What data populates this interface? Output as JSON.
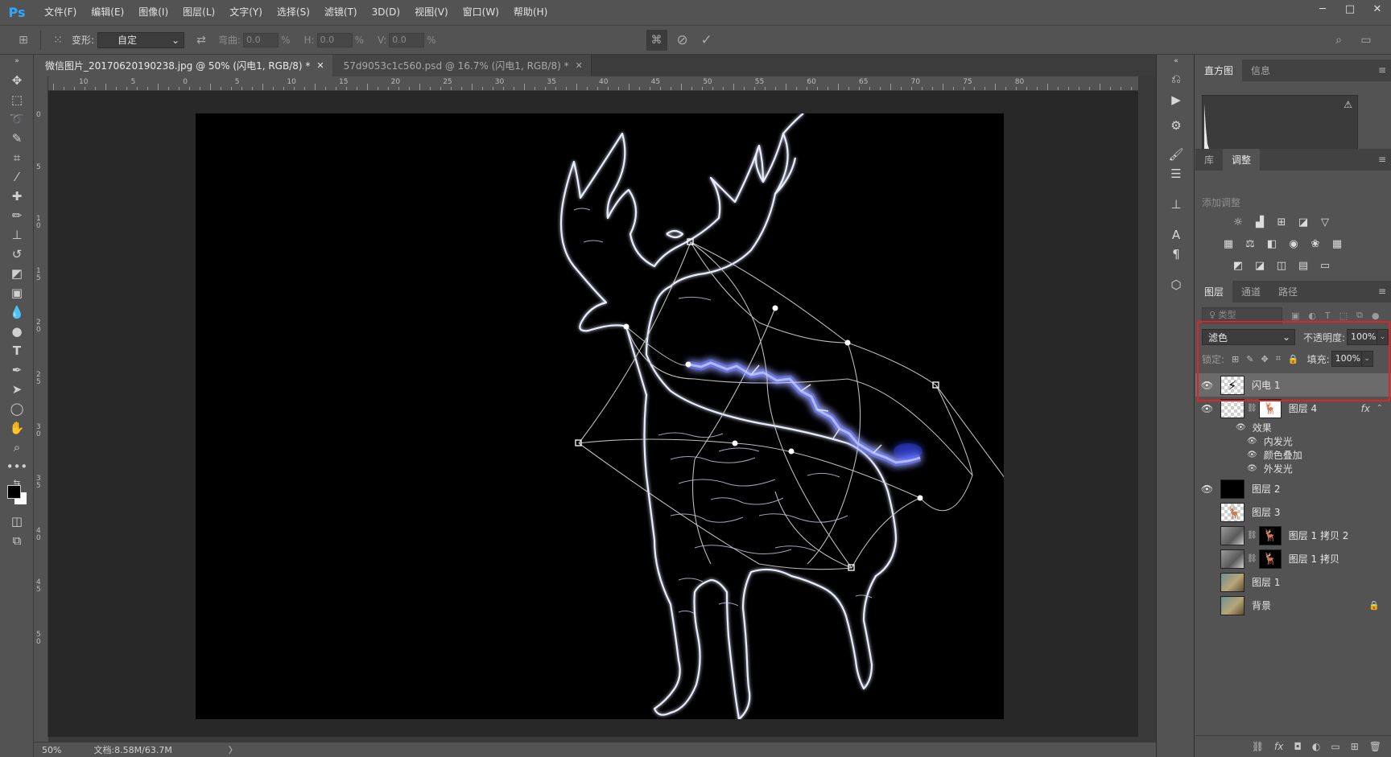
{
  "app": {
    "logo": "Ps"
  },
  "menu": [
    "文件(F)",
    "编辑(E)",
    "图像(I)",
    "图层(L)",
    "文字(Y)",
    "选择(S)",
    "滤镜(T)",
    "3D(D)",
    "视图(V)",
    "窗口(W)",
    "帮助(H)"
  ],
  "window_controls": [
    "─",
    "□",
    "✕"
  ],
  "options": {
    "warp_label": "变形:",
    "warp_value": "自定",
    "bend_label": "弯曲:",
    "bend_value": "0.0",
    "bend_unit": "%",
    "h_label": "H:",
    "h_value": "0.0",
    "h_unit": "%",
    "v_label": "V:",
    "v_value": "0.0",
    "v_unit": "%"
  },
  "tabs": [
    {
      "label": "微信图片_20170620190238.jpg @ 50% (闪电1, RGB/8) *",
      "close": "✕"
    },
    {
      "label": "57d9053c1c560.psd @ 16.7% (闪电1, RGB/8) *",
      "close": "✕"
    }
  ],
  "ruler": {
    "h_labels": [
      "10",
      "5",
      "0",
      "5",
      "10",
      "15",
      "20",
      "25",
      "30",
      "35",
      "40",
      "45",
      "50",
      "55",
      "60",
      "65",
      "70",
      "75",
      "80"
    ],
    "v_labels": [
      "0",
      "5",
      "1 0",
      "1 5",
      "2 0",
      "2 5",
      "3 0",
      "3 5",
      "4 0",
      "4 5",
      "5 0"
    ]
  },
  "status": {
    "zoom": "50%",
    "doc": "文档:8.58M/63.7M",
    "arrow": "〉"
  },
  "panels": {
    "top_tabs": [
      "直方图",
      "信息"
    ],
    "mid_tabs": [
      "库",
      "调整"
    ],
    "adjust_title": "添加调整",
    "layer_tabs": [
      "图层",
      "通道",
      "路径"
    ],
    "kind_placeholder": "♀ 类型",
    "blend_mode": "滤色",
    "opacity_label": "不透明度:",
    "opacity_value": "100%",
    "lock_label": "锁定:",
    "fill_label": "填充:",
    "fill_value": "100%",
    "histogram_warning": "⚠"
  },
  "layers": [
    {
      "name": "闪电 1",
      "visible": true,
      "selected": true
    },
    {
      "name": "图层 4",
      "visible": true,
      "fx": "fx"
    },
    {
      "name": "图层 2",
      "visible": true
    },
    {
      "name": "图层 3",
      "visible": false
    },
    {
      "name": "图层 1 拷贝 2",
      "visible": false
    },
    {
      "name": "图层 1 拷贝",
      "visible": false
    },
    {
      "name": "图层 1",
      "visible": false
    },
    {
      "name": "背景",
      "visible": false,
      "locked": true
    }
  ],
  "effects": {
    "title": "效果",
    "items": [
      "内发光",
      "颜色叠加",
      "外发光"
    ]
  },
  "colors": {
    "accent": "#31a8ff",
    "highlight": "#e02424",
    "glow": "#6f7dff"
  }
}
